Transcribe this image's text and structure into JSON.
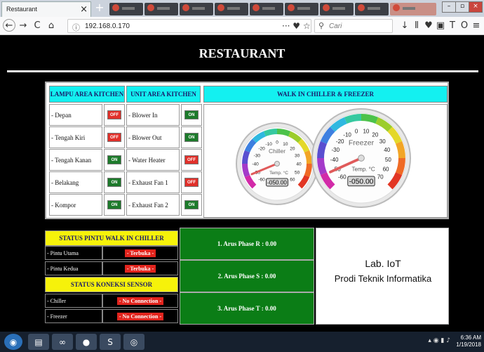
{
  "browser": {
    "tab_title": "Restaurant",
    "tab_close": "×",
    "new_tab": "+",
    "url": "192.168.0.170",
    "search_placeholder": "Cari",
    "page_actions": "··· ♥ ☆",
    "nav": {
      "back": "←",
      "forward": "→",
      "reload": "C",
      "home": "⌂",
      "info": "ⓘ"
    },
    "toolbar_icons": [
      "download-icon",
      "library-icon",
      "shield-icon",
      "reader-icon",
      "extension-t-icon",
      "extension-o-icon",
      "menu-icon"
    ],
    "toolbar_glyphs": [
      "↓",
      "⫴",
      "♥",
      "▣",
      "T",
      "O",
      "≡"
    ]
  },
  "page": {
    "title": "RESTAURANT"
  },
  "lampu": {
    "header": "LAMPU AREA KITCHEN",
    "items": [
      {
        "label": "- Depan",
        "state": "OFF"
      },
      {
        "label": "- Tengah Kiri",
        "state": "OFF"
      },
      {
        "label": "- Tengah Kanan",
        "state": "ON"
      },
      {
        "label": "- Belakang",
        "state": "ON"
      },
      {
        "label": "- Kompor",
        "state": "ON"
      }
    ]
  },
  "unit": {
    "header": "UNIT AREA KITCHEN",
    "items": [
      {
        "label": "- Blower In",
        "state": "ON"
      },
      {
        "label": "- Blower Out",
        "state": "ON"
      },
      {
        "label": "- Water Heater",
        "state": "OFF"
      },
      {
        "label": "- Exhaust Fan 1",
        "state": "OFF"
      },
      {
        "label": "- Exhaust Fan 2",
        "state": "ON"
      }
    ]
  },
  "walkin": {
    "header": "WALK IN CHILLER & FREEZER",
    "chiller": {
      "name": "Chiller",
      "unit": "Temp. °C",
      "value": "-050.00",
      "reading": -50,
      "min": -60,
      "max": 60,
      "ticks": [
        "-60",
        "-50",
        "-40",
        "-30",
        "-20",
        "-10",
        "0",
        "10",
        "20",
        "30",
        "40",
        "50",
        "60"
      ]
    },
    "freezer": {
      "name": "Freezer",
      "unit": "Temp. °C",
      "value": "-050.00",
      "reading": -50,
      "min": -60,
      "max": 70,
      "ticks": [
        "-60",
        "-50",
        "-40",
        "-30",
        "-20",
        "-10",
        "0",
        "10",
        "20",
        "30",
        "40",
        "50",
        "60",
        "70"
      ]
    }
  },
  "pintu": {
    "header": "STATUS PINTU WALK IN CHILLER",
    "items": [
      {
        "label": "- Pintu Utama",
        "status": "- Terbuka -"
      },
      {
        "label": "- Pintu Kedua",
        "status": "- Terbuka -"
      }
    ]
  },
  "sensor": {
    "header": "STATUS KONEKSI SENSOR",
    "items": [
      {
        "label": "- Chiller",
        "status": "- No Connection -"
      },
      {
        "label": "- Freezer",
        "status": "- No Connection -"
      }
    ]
  },
  "phases": [
    {
      "label": "1. Arus Phase R : 0.00"
    },
    {
      "label": "2. Arus Phase S : 0.00"
    },
    {
      "label": "3. Arus Phase T : 0.00"
    }
  ],
  "lab": {
    "line1": "Lab. IoT",
    "line2": "Prodi Teknik Informatika"
  },
  "taskbar": {
    "apps": [
      "start-orb-icon",
      "file-explorer-icon",
      "arduino-icon",
      "firefox-icon",
      "sublime-icon",
      "chrome-icon"
    ],
    "app_glyphs": [
      "◉",
      "▤",
      "∞",
      "●",
      "S",
      "◎"
    ],
    "tray": "▴ ◉ ▮ ♪",
    "time": "6:36 AM",
    "date": "1/19/2018"
  },
  "colors": {
    "header_cyan": "#13f0f0",
    "header_yellow": "#f6f20a",
    "phase_green": "#0b7d16",
    "switch_on": "#1d7a2b",
    "switch_off": "#e0302a",
    "status_red": "#e2241d"
  }
}
